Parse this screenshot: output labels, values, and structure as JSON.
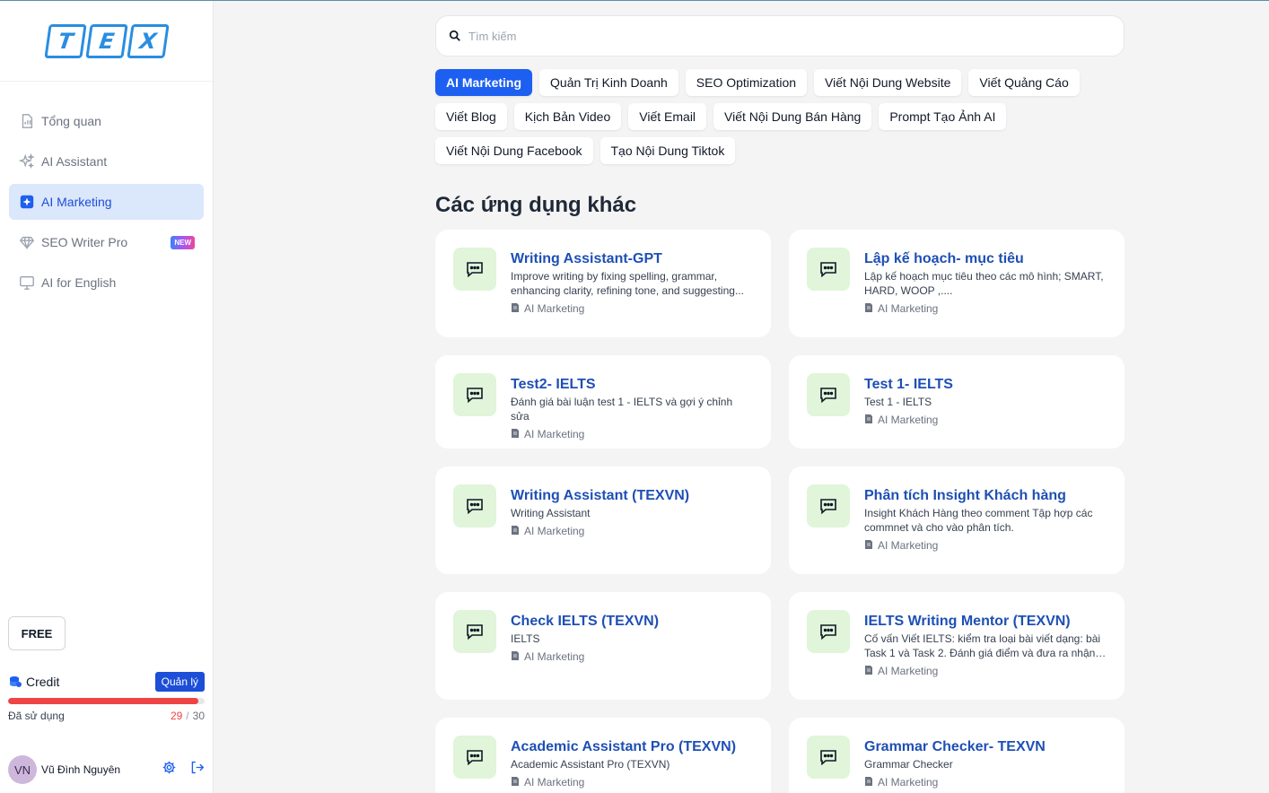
{
  "logo": {
    "letters": [
      "T",
      "E",
      "X"
    ]
  },
  "sidebar": {
    "items": [
      {
        "label": "Tổng quan",
        "icon": "chart-report-icon"
      },
      {
        "label": "AI Assistant",
        "icon": "sparkles-icon"
      },
      {
        "label": "AI Marketing",
        "icon": "star-square-icon",
        "active": true
      },
      {
        "label": "SEO Writer Pro",
        "icon": "diamond-icon",
        "badge": "NEW"
      },
      {
        "label": "AI for English",
        "icon": "monitor-icon"
      }
    ],
    "plan_label": "FREE",
    "credit": {
      "title": "Credit",
      "manage_label": "Quản lý",
      "usage_label": "Đã sử dụng",
      "used": "29",
      "separator": "/",
      "total": "30",
      "used_fraction": 0.9667
    },
    "user": {
      "initials": "VN",
      "name": "Vũ Đình Nguyên"
    }
  },
  "search": {
    "placeholder": "Tìm kiếm",
    "value": ""
  },
  "tags": [
    {
      "label": "AI Marketing",
      "active": true
    },
    {
      "label": "Quản Trị Kinh Doanh"
    },
    {
      "label": "SEO Optimization"
    },
    {
      "label": "Viết Nội Dung Website"
    },
    {
      "label": "Viết Quảng Cáo"
    },
    {
      "label": "Viết Blog"
    },
    {
      "label": "Kịch Bản Video"
    },
    {
      "label": "Viết Email"
    },
    {
      "label": "Viết Nội Dung Bán Hàng"
    },
    {
      "label": "Prompt Tạo Ảnh AI"
    },
    {
      "label": "Viết Nội Dung Facebook"
    },
    {
      "label": "Tạo Nội Dung Tiktok"
    }
  ],
  "section_title": "Các ứng dụng khác",
  "apps": [
    {
      "title": "Writing Assistant-GPT",
      "desc": "Improve writing by fixing spelling, grammar, enhancing clarity, refining tone, and suggesting...",
      "category": "AI Marketing"
    },
    {
      "title": "Lập kế hoạch- mục tiêu",
      "desc": "Lập kế hoạch mục tiêu theo các mô hình; SMART, HARD, WOOP ,....",
      "category": "AI Marketing"
    },
    {
      "title": "Test2- IELTS",
      "desc": "Đánh giá bài luận test 1 - IELTS và gợi ý chỉnh sửa",
      "category": "AI Marketing"
    },
    {
      "title": "Test 1- IELTS",
      "desc": "Test 1 - IELTS",
      "category": "AI Marketing"
    },
    {
      "title": "Writing Assistant (TEXVN)",
      "desc": "Writing Assistant",
      "category": "AI Marketing"
    },
    {
      "title": "Phân tích Insight Khách hàng",
      "desc": "Insight Khách Hàng theo comment Tập hợp các commnet và cho vào phân tích.",
      "category": "AI Marketing"
    },
    {
      "title": "Check IELTS (TEXVN)",
      "desc": "IELTS",
      "category": "AI Marketing"
    },
    {
      "title": "IELTS Writing Mentor (TEXVN)",
      "desc": "Cố vấn Viết IELTS: kiểm tra loại bài viết dạng: bài Task 1 và Task 2. Đánh giá điểm và đưa ra nhận x...",
      "category": "AI Marketing"
    },
    {
      "title": "Academic Assistant Pro (TEXVN)",
      "desc": "Academic Assistant Pro (TEXVN)",
      "category": "AI Marketing"
    },
    {
      "title": "Grammar Checker- TEXVN",
      "desc": "Grammar Checker",
      "category": "AI Marketing"
    }
  ],
  "colors": {
    "accent": "#1d5ff0",
    "title_blue": "#1e4fb5",
    "danger": "#ef4444",
    "card_icon_bg": "#e0f5d9"
  }
}
